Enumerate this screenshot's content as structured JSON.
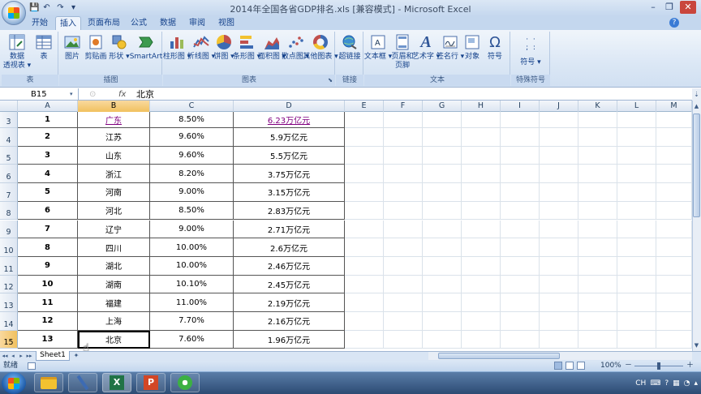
{
  "window": {
    "title": "2014年全国各省GDP排名.xls  [兼容模式] - Microsoft Excel",
    "controls": {
      "minimize": "–",
      "restore": "❐",
      "close": "✕"
    }
  },
  "quick_access": {
    "save": "💾",
    "undo": "↶",
    "redo": "↷",
    "more": "▾"
  },
  "tabs": [
    {
      "label": "开始",
      "active": false
    },
    {
      "label": "插入",
      "active": true
    },
    {
      "label": "页面布局",
      "active": false
    },
    {
      "label": "公式",
      "active": false
    },
    {
      "label": "数据",
      "active": false
    },
    {
      "label": "审阅",
      "active": false
    },
    {
      "label": "视图",
      "active": false
    }
  ],
  "ribbon": {
    "groups": {
      "tables": "表",
      "illustrations": "插图",
      "charts": "图表",
      "links": "链接",
      "text": "文本",
      "special": "特殊符号"
    },
    "buttons": {
      "pivot": "数据\n透视表 ▾",
      "table": "表",
      "picture": "图片",
      "clipart": "剪贴画",
      "shapes": "形状 ▾",
      "smartart": "SmartArt",
      "column": "柱形图 ▾",
      "line": "折线图 ▾",
      "pie": "饼图 ▾",
      "bar": "条形图 ▾",
      "area": "面积图 ▾",
      "scatter": "散点图 ▾",
      "other": "其他图表 ▾",
      "hyperlink": "超链接",
      "textbox": "文本框 ▾",
      "header": "页眉和\n页脚",
      "wordart": "艺术字 ▾",
      "signature": "签名行 ▾",
      "object": "对象",
      "symbol": "符号",
      "special_symbol": "符号 ▾"
    }
  },
  "formula_bar": {
    "name_box": "B15",
    "fx": "fx",
    "content": "北京"
  },
  "columns": [
    "A",
    "B",
    "C",
    "D",
    "E",
    "F",
    "G",
    "H",
    "I",
    "J",
    "K",
    "L",
    "M"
  ],
  "selected_column": "B",
  "rows": [
    {
      "row": "3",
      "rank": "1",
      "province": "广东",
      "growth": "8.50%",
      "gdp": "6.23万亿元",
      "link": true
    },
    {
      "row": "4",
      "rank": "2",
      "province": "江苏",
      "growth": "9.60%",
      "gdp": "5.9万亿元"
    },
    {
      "row": "5",
      "rank": "3",
      "province": "山东",
      "growth": "9.60%",
      "gdp": "5.5万亿元"
    },
    {
      "row": "6",
      "rank": "4",
      "province": "浙江",
      "growth": "8.20%",
      "gdp": "3.75万亿元"
    },
    {
      "row": "7",
      "rank": "5",
      "province": "河南",
      "growth": "9.00%",
      "gdp": "3.15万亿元"
    },
    {
      "row": "8",
      "rank": "6",
      "province": "河北",
      "growth": "8.50%",
      "gdp": "2.83万亿元"
    },
    {
      "row": "9",
      "rank": "7",
      "province": "辽宁",
      "growth": "9.00%",
      "gdp": "2.71万亿元"
    },
    {
      "row": "10",
      "rank": "8",
      "province": "四川",
      "growth": "10.00%",
      "gdp": "2.6万亿元"
    },
    {
      "row": "11",
      "rank": "9",
      "province": "湖北",
      "growth": "10.00%",
      "gdp": "2.46万亿元"
    },
    {
      "row": "12",
      "rank": "10",
      "province": "湖南",
      "growth": "10.10%",
      "gdp": "2.45万亿元"
    },
    {
      "row": "13",
      "rank": "11",
      "province": "福建",
      "growth": "11.00%",
      "gdp": "2.19万亿元"
    },
    {
      "row": "14",
      "rank": "12",
      "province": "上海",
      "growth": "7.70%",
      "gdp": "2.16万亿元"
    },
    {
      "row": "15",
      "rank": "13",
      "province": "北京",
      "growth": "7.60%",
      "gdp": "1.96万亿元",
      "selected": true
    }
  ],
  "sheet": {
    "tab": "Sheet1",
    "nav": [
      "◂◂",
      "◂",
      "▸",
      "▸▸"
    ]
  },
  "status": {
    "ready": "就绪",
    "zoom": "100%",
    "zoom_minus": "－",
    "zoom_plus": "＋"
  },
  "taskbar": {
    "tray_lang": "CH"
  }
}
